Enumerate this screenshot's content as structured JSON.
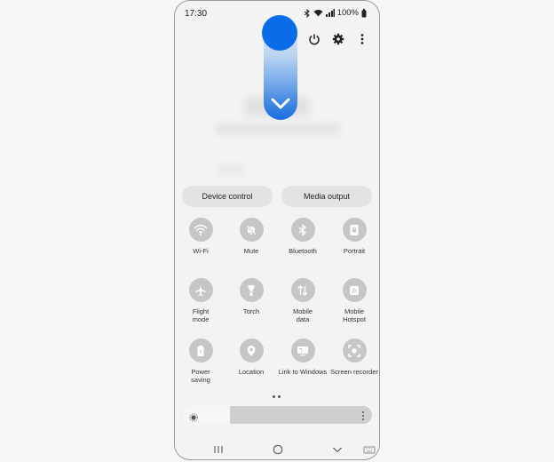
{
  "status_bar": {
    "time": "17:30",
    "battery": "100%"
  },
  "top_actions": {
    "icons": [
      "power-icon",
      "gear-icon",
      "more-vert-icon"
    ]
  },
  "panels": {
    "device_control": "Device control",
    "media_output": "Media output"
  },
  "tiles": [
    {
      "label": "Wi-Fi",
      "icon": "wifi-icon"
    },
    {
      "label": "Mute",
      "icon": "mute-icon"
    },
    {
      "label": "Bluetooth",
      "icon": "bluetooth-icon"
    },
    {
      "label": "Portrait",
      "icon": "portrait-icon"
    },
    {
      "label": "Flight\nmode",
      "icon": "airplane-icon"
    },
    {
      "label": "Torch",
      "icon": "torch-icon"
    },
    {
      "label": "Mobile\ndata",
      "icon": "mobile-data-icon"
    },
    {
      "label": "Mobile\nHotspot",
      "icon": "hotspot-icon"
    },
    {
      "label": "Power\nsaving",
      "icon": "battery-icon"
    },
    {
      "label": "Location",
      "icon": "location-icon"
    },
    {
      "label": "Link to Windows",
      "icon": "link-windows-icon"
    },
    {
      "label": "Screen recorder",
      "icon": "screen-recorder-icon"
    }
  ],
  "brightness": {
    "level": 0.25
  },
  "colors": {
    "swipe_accent": "#0a6ce8",
    "tile_off": "#c6c6c6"
  }
}
